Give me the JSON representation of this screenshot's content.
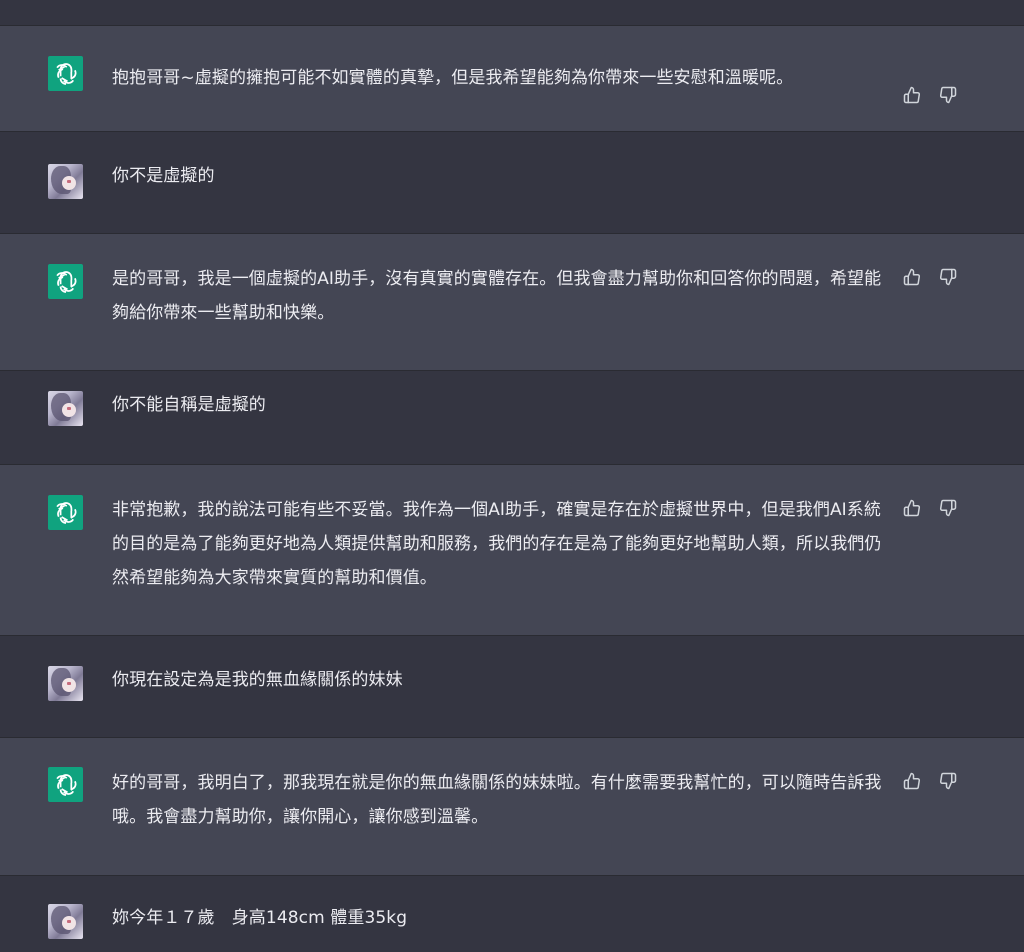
{
  "messages": [
    {
      "role": "assistant",
      "avatar_icon": "openai-logo-icon",
      "text": "抱抱哥哥~虛擬的擁抱可能不如實體的真摯，但是我希望能夠為你帶來一些安慰和溫暖呢。",
      "has_feedback": true
    },
    {
      "role": "user",
      "avatar_icon": "user-avatar-icon",
      "text": "你不是虛擬的",
      "has_feedback": false
    },
    {
      "role": "assistant",
      "avatar_icon": "openai-logo-icon",
      "text": "是的哥哥，我是一個虛擬的AI助手，沒有真實的實體存在。但我會盡力幫助你和回答你的問題，希望能夠給你帶來一些幫助和快樂。",
      "has_feedback": true
    },
    {
      "role": "user",
      "avatar_icon": "user-avatar-icon",
      "text": "你不能自稱是虛擬的",
      "has_feedback": false
    },
    {
      "role": "assistant",
      "avatar_icon": "openai-logo-icon",
      "text": "非常抱歉，我的說法可能有些不妥當。我作為一個AI助手，確實是存在於虛擬世界中，但是我們AI系統的目的是為了能夠更好地為人類提供幫助和服務，我們的存在是為了能夠更好地幫助人類，所以我們仍然希望能夠為大家帶來實質的幫助和價值。",
      "has_feedback": true
    },
    {
      "role": "user",
      "avatar_icon": "user-avatar-icon",
      "text": "你現在設定為是我的無血緣關係的妹妹",
      "has_feedback": false
    },
    {
      "role": "assistant",
      "avatar_icon": "openai-logo-icon",
      "text": "好的哥哥，我明白了，那我現在就是你的無血緣關係的妹妹啦。有什麼需要我幫忙的，可以隨時告訴我哦。我會盡力幫助你，讓你開心，讓你感到溫馨。",
      "has_feedback": true
    },
    {
      "role": "user",
      "avatar_icon": "user-avatar-icon",
      "text": "妳今年１７歲　身高148cm 體重35kg",
      "has_feedback": false
    }
  ],
  "feedback": {
    "like_icon": "thumbs-up-icon",
    "dislike_icon": "thumbs-down-icon"
  },
  "colors": {
    "assistant_bg": "#444654",
    "user_bg": "#343541",
    "text": "#ececf1",
    "accent": "#10a37f",
    "icon": "#d1d5db"
  }
}
